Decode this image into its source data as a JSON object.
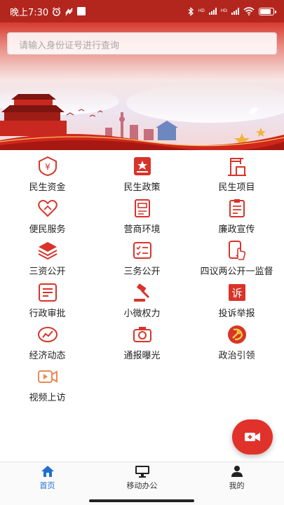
{
  "status_bar": {
    "time": "晚上7:30",
    "network_labels": [
      "HD",
      "HD"
    ],
    "battery_level": 0.85
  },
  "search": {
    "placeholder": "请输入身份证号进行查询"
  },
  "menu": [
    {
      "label": "民生资金",
      "icon": "money-shield-icon"
    },
    {
      "label": "民生政策",
      "icon": "policy-document-icon"
    },
    {
      "label": "民生项目",
      "icon": "construction-crane-icon"
    },
    {
      "label": "便民服务",
      "icon": "heart-hands-icon"
    },
    {
      "label": "营商环境",
      "icon": "business-document-icon"
    },
    {
      "label": "廉政宣传",
      "icon": "clipboard-icon"
    },
    {
      "label": "三资公开",
      "icon": "layers-icon"
    },
    {
      "label": "三务公开",
      "icon": "checklist-icon"
    },
    {
      "label": "四议两公开一监督",
      "icon": "mobile-touch-icon"
    },
    {
      "label": "行政审批",
      "icon": "approval-list-icon"
    },
    {
      "label": "小微权力",
      "icon": "gavel-icon"
    },
    {
      "label": "投诉举报",
      "icon": "complaint-icon"
    },
    {
      "label": "经济动态",
      "icon": "economy-trend-icon"
    },
    {
      "label": "通报曝光",
      "icon": "camera-icon"
    },
    {
      "label": "政治引领",
      "icon": "hammer-sickle-icon"
    },
    {
      "label": "视频上访",
      "icon": "video-play-icon"
    }
  ],
  "tabbar": [
    {
      "label": "首页",
      "icon": "home-icon",
      "active": true
    },
    {
      "label": "移动办公",
      "icon": "monitor-icon",
      "active": false
    },
    {
      "label": "我的",
      "icon": "user-icon",
      "active": false
    }
  ],
  "colors": {
    "brand_red": "#d8342a",
    "status_red": "#b3261e",
    "active_blue": "#1f6fd1"
  }
}
